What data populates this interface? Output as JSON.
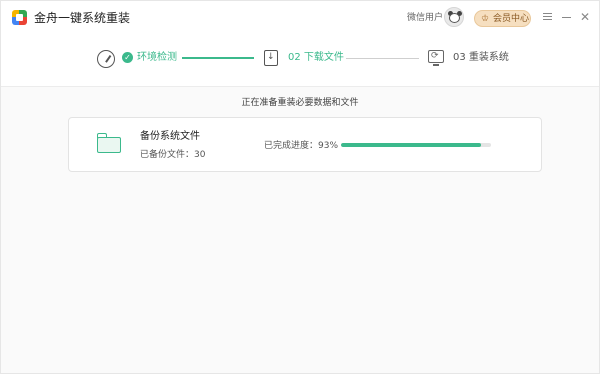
{
  "app": {
    "title": "金舟一键系统重装"
  },
  "header": {
    "user_name": "微信用户",
    "vip_label": "会员中心"
  },
  "steps": [
    {
      "label": "环境检测",
      "state": "done"
    },
    {
      "label": "02 下载文件",
      "state": "active"
    },
    {
      "label": "03 重装系统",
      "state": "pending"
    }
  ],
  "main": {
    "status_text": "正在准备重装必要数据和文件",
    "card": {
      "title": "备份系统文件",
      "backed_up": "已备份文件：30",
      "progress_label": "已完成进度：93%",
      "progress_value": 93
    }
  },
  "colors": {
    "accent": "#3bb98c",
    "vip_bg": "#f6dfc0"
  },
  "icons": [
    "app-logo-icon",
    "avatar",
    "crown-icon",
    "menu-icon",
    "minimize-icon",
    "close-icon",
    "gauge-icon",
    "check-icon",
    "download-file-icon",
    "monitor-reinstall-icon",
    "folder-icon"
  ]
}
